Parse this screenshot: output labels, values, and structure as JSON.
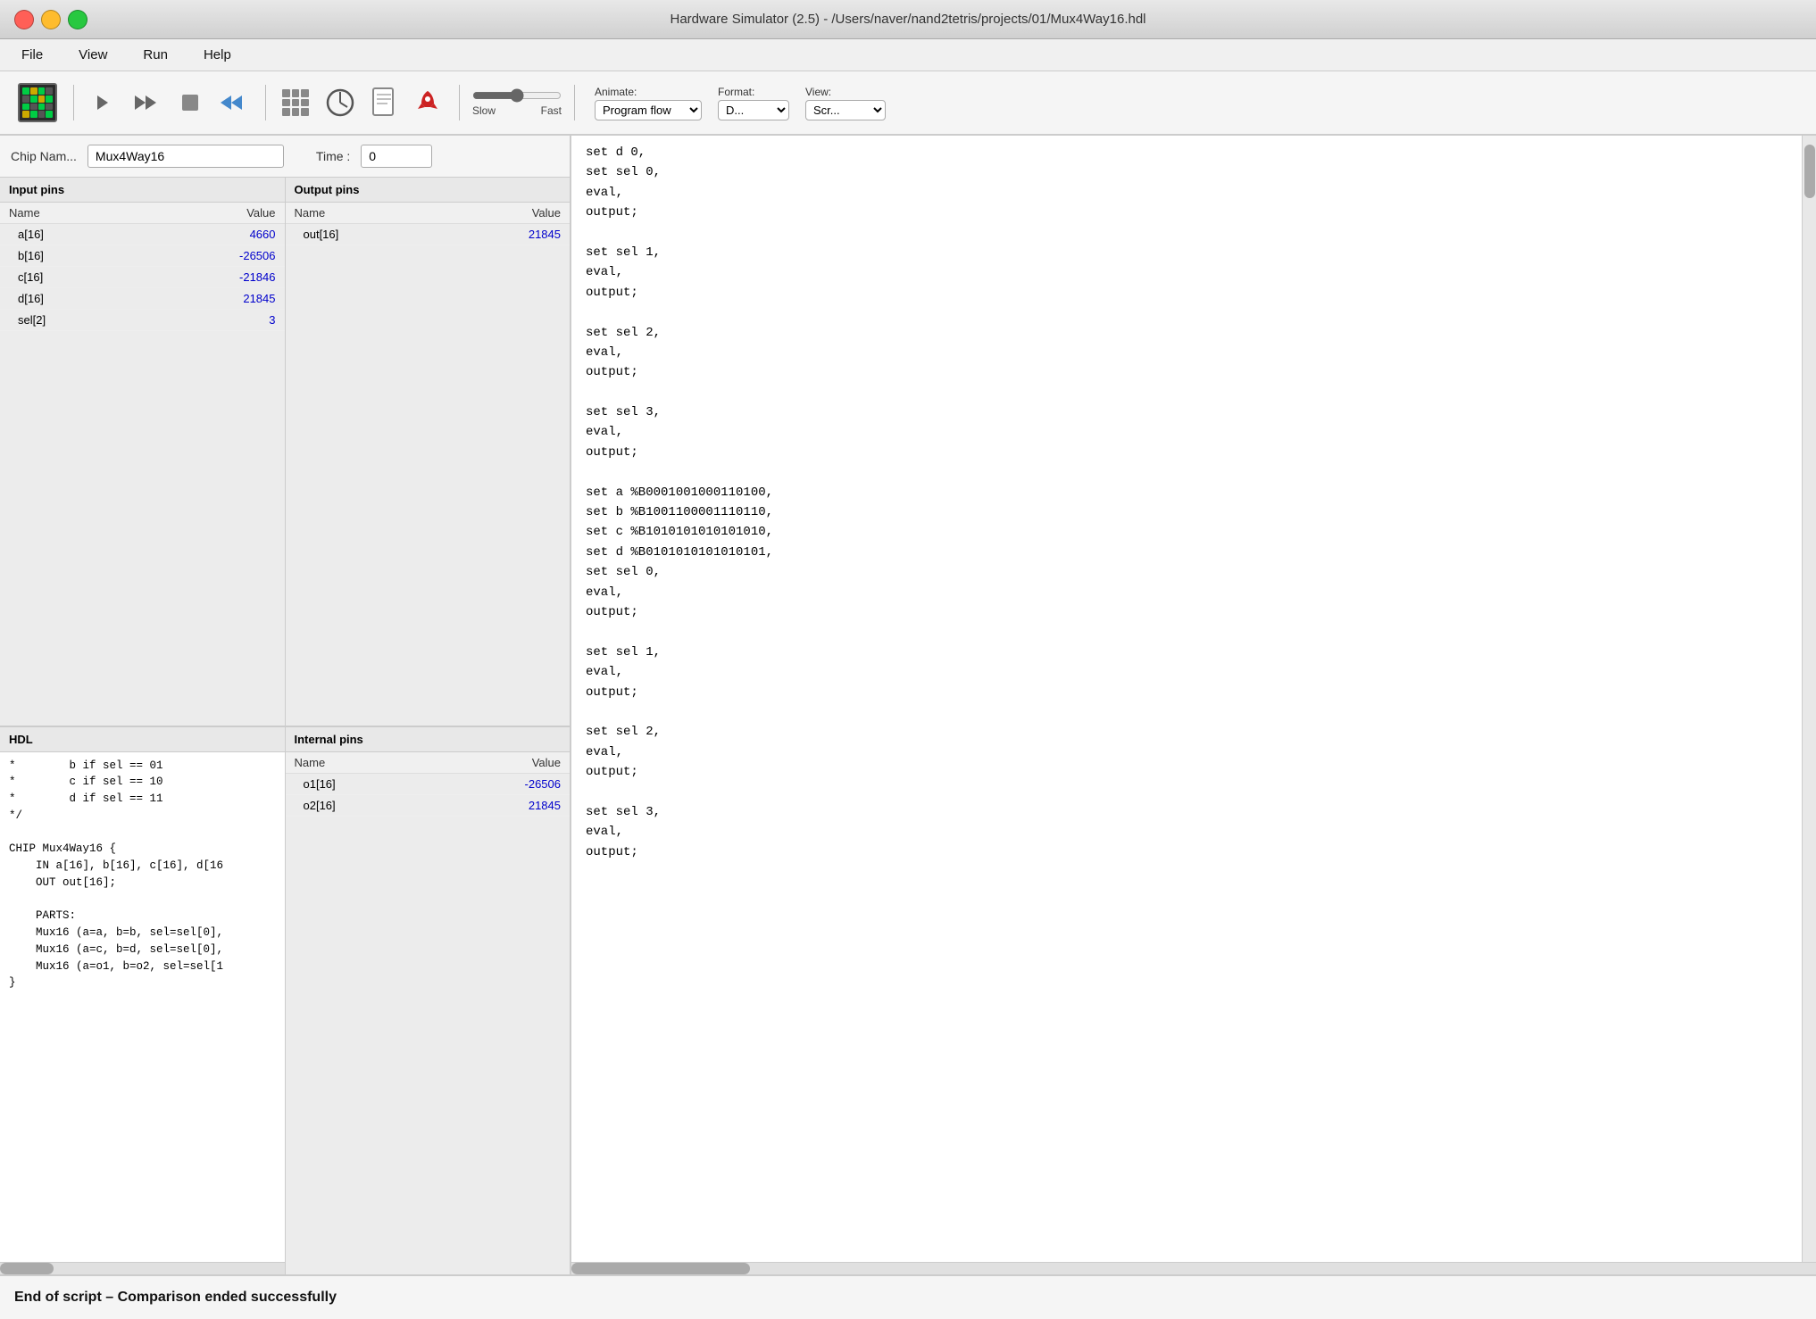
{
  "window": {
    "title": "Hardware Simulator (2.5) - /Users/naver/nand2tetris/projects/01/Mux4Way16.hdl",
    "buttons": {
      "close": "close",
      "minimize": "minimize",
      "maximize": "maximize"
    }
  },
  "menubar": {
    "items": [
      "File",
      "View",
      "Run",
      "Help"
    ]
  },
  "toolbar": {
    "speed_label_slow": "Slow",
    "speed_label_fast": "Fast",
    "animate_label": "Animate:",
    "animate_value": "Program flow",
    "format_label": "Format:",
    "format_value": "D...",
    "view_label": "View:",
    "view_value": "Scr..."
  },
  "chip": {
    "name_label": "Chip Nam...",
    "name_value": "Mux4Way16",
    "time_label": "Time :",
    "time_value": "0"
  },
  "input_pins": {
    "header": "Input pins",
    "col_name": "Name",
    "col_value": "Value",
    "pins": [
      {
        "name": "a[16]",
        "value": "4660"
      },
      {
        "name": "b[16]",
        "value": "-26506"
      },
      {
        "name": "c[16]",
        "value": "-21846"
      },
      {
        "name": "d[16]",
        "value": "21845"
      },
      {
        "name": "sel[2]",
        "value": "3"
      }
    ]
  },
  "output_pins": {
    "header": "Output pins",
    "col_name": "Name",
    "col_value": "Value",
    "pins": [
      {
        "name": "out[16]",
        "value": "21845"
      }
    ]
  },
  "hdl": {
    "header": "HDL",
    "content": "*        b if sel == 01\n*        c if sel == 10\n*        d if sel == 11\n*/\n\nCHIP Mux4Way16 {\n    IN a[16], b[16], c[16], d[16\n    OUT out[16];\n\n    PARTS:\n    Mux16 (a=a, b=b, sel=sel[0],\n    Mux16 (a=c, b=d, sel=sel[0],\n    Mux16 (a=o1, b=o2, sel=sel[1\n}"
  },
  "internal_pins": {
    "header": "Internal pins",
    "col_name": "Name",
    "col_value": "Value",
    "pins": [
      {
        "name": "o1[16]",
        "value": "-26506"
      },
      {
        "name": "o2[16]",
        "value": "21845"
      }
    ]
  },
  "script": {
    "lines": [
      "set d 0,",
      "set sel 0,",
      "eval,",
      "output;",
      "",
      "set sel 1,",
      "eval,",
      "output;",
      "",
      "set sel 2,",
      "eval,",
      "output;",
      "",
      "set sel 3,",
      "eval,",
      "output;",
      "",
      "set a %B0001001000110100,",
      "set b %B1001100001110110,",
      "set c %B1010101010101010,",
      "set d %B0101010101010101,",
      "set sel 0,",
      "eval,",
      "output;",
      "",
      "set sel 1,",
      "eval,",
      "output;",
      "",
      "set sel 2,",
      "eval,",
      "output;",
      "",
      "set sel 3,",
      "eval,",
      "output;"
    ],
    "highlighted_line": 36
  },
  "statusbar": {
    "message": "End of script – Comparison ended successfully"
  }
}
